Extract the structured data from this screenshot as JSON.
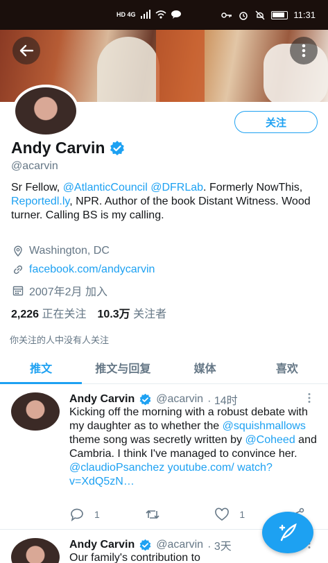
{
  "status_bar": {
    "network": "HD 4G",
    "time": "11:31"
  },
  "profile": {
    "follow_label": "关注",
    "name": "Andy Carvin",
    "handle": "@acarvin",
    "bio": {
      "t1": "Sr Fellow, ",
      "l1": "@AtlanticCouncil",
      "t2": " ",
      "l2": "@DFRLab",
      "t3": ". Formerly NowThis, ",
      "l3": "Reportedl.ly",
      "t4": ", NPR. Author of the book Distant Witness. Wood turner. Calling BS is my calling."
    },
    "location": "Washington, DC",
    "website": "facebook.com/andycarvin",
    "joined": "2007年2月 加入",
    "following_count": "2,226",
    "following_label": "正在关注",
    "followers_count": "10.3万",
    "followers_label": "关注者",
    "no_common": "你关注的人中没有人关注"
  },
  "tabs": [
    {
      "label": "推文",
      "active": true
    },
    {
      "label": "推文与回复",
      "active": false
    },
    {
      "label": "媒体",
      "active": false
    },
    {
      "label": "喜欢",
      "active": false
    }
  ],
  "tweets": [
    {
      "name": "Andy Carvin",
      "handle": "@acarvin",
      "time": "· 14时",
      "text_1": "Kicking off the morning with a robust debate with my daughter as to whether the ",
      "link_1": "@squishmallows",
      "text_2": " theme song was secretly written by ",
      "link_2": "@Coheed",
      "text_3": " and Cambria. I think I've managed to convince her. ",
      "link_3": " @claudioPsanchez youtube.com/ watch?v=XdQ5zN…",
      "replies": "1",
      "retweets": "",
      "likes": "1"
    },
    {
      "name": "Andy Carvin",
      "handle": "@acarvin",
      "time": "· 3天",
      "text_1": "Our family's contribution to"
    }
  ],
  "colors": {
    "accent": "#1da1f2",
    "secondary_text": "#657786",
    "primary_text": "#14171a"
  }
}
